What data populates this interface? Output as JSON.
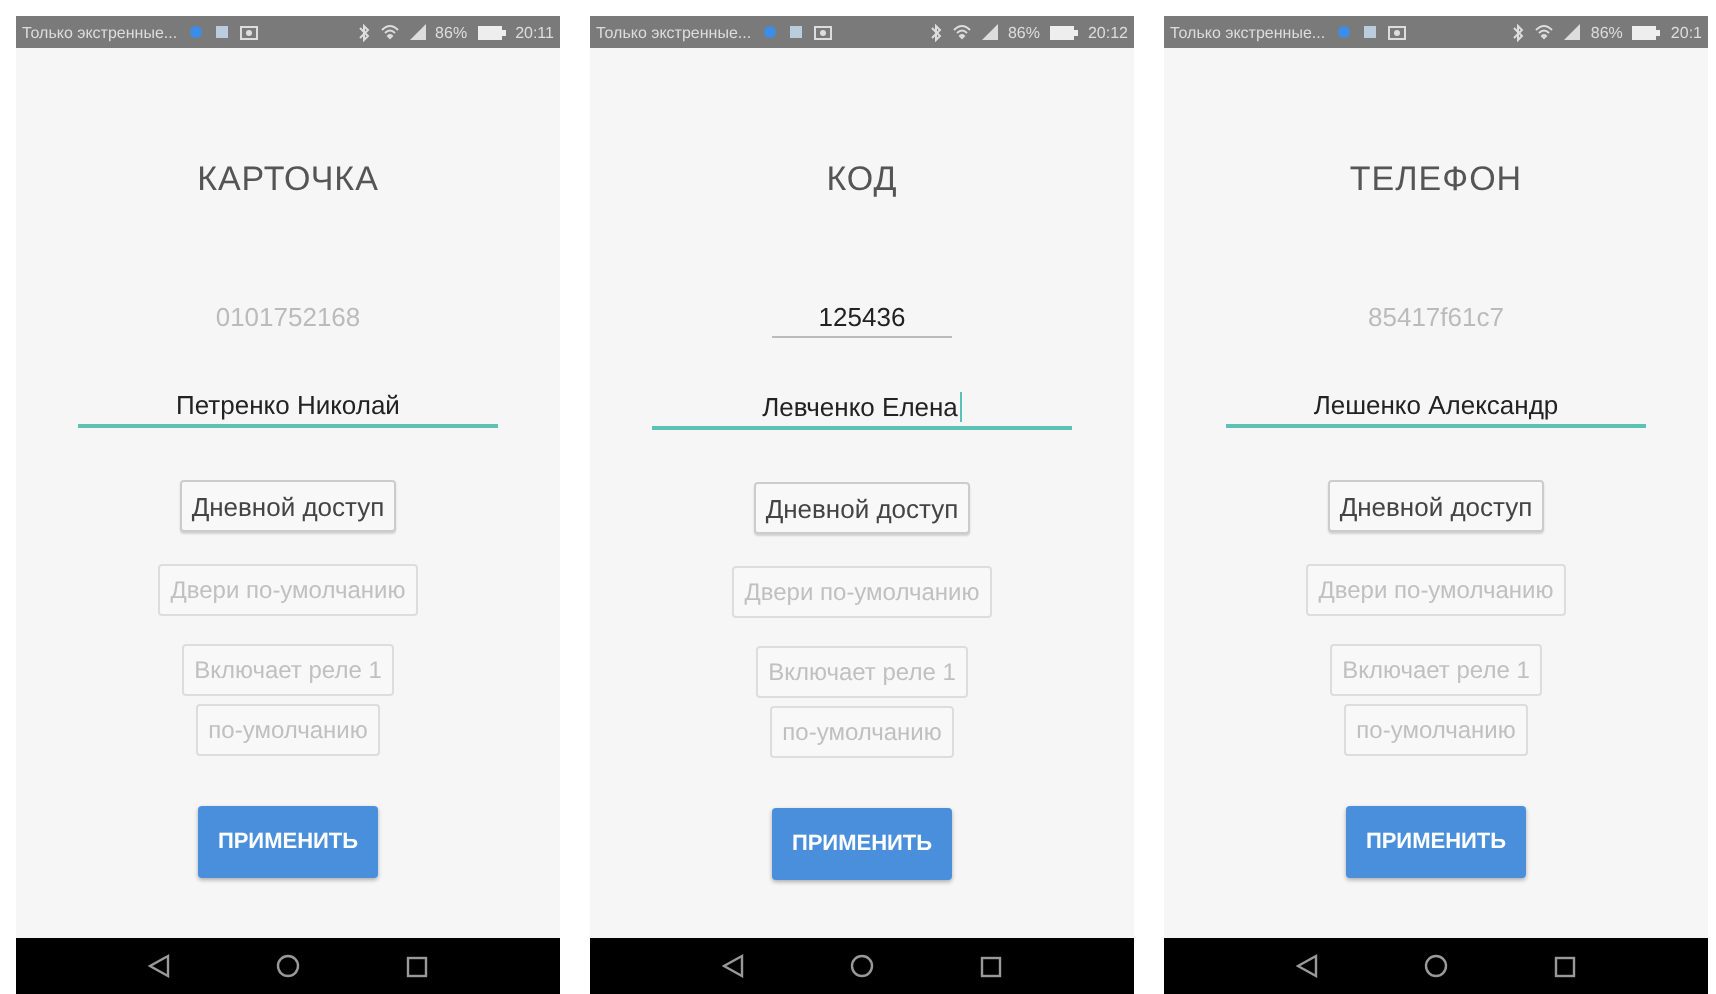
{
  "screens": [
    {
      "status_bar": {
        "notice": "Только экстренные...",
        "battery": "86%",
        "time": "20:11"
      },
      "title": "КАРТОЧКА",
      "code_field": {
        "value": "0101752168",
        "disabled": true
      },
      "name_field": {
        "value": "Петренко Николай",
        "focused": true,
        "cursor": false
      },
      "buttons": [
        {
          "label": "Дневной доступ",
          "disabled": false
        },
        {
          "label": "Двери по-умолчанию",
          "disabled": true
        },
        {
          "label": "Включает реле 1",
          "disabled": true
        },
        {
          "label": "по-умолчанию",
          "disabled": true
        }
      ],
      "apply_button": "ПРИМЕНИТЬ"
    },
    {
      "status_bar": {
        "notice": "Только экстренные...",
        "battery": "86%",
        "time": "20:12"
      },
      "title": "КОД",
      "code_field": {
        "value": "125436",
        "disabled": false
      },
      "name_field": {
        "value": "Левченко Елена",
        "focused": true,
        "cursor": true
      },
      "buttons": [
        {
          "label": "Дневной доступ",
          "disabled": false
        },
        {
          "label": "Двери по-умолчанию",
          "disabled": true
        },
        {
          "label": "Включает реле 1",
          "disabled": true
        },
        {
          "label": "по-умолчанию",
          "disabled": true
        }
      ],
      "apply_button": "ПРИМЕНИТЬ"
    },
    {
      "status_bar": {
        "notice": "Только экстренные...",
        "battery": "86%",
        "time": "20:1"
      },
      "title": "ТЕЛЕФОН",
      "code_field": {
        "value": "85417f61c7",
        "disabled": true
      },
      "name_field": {
        "value": "Лешенко Александр",
        "focused": true,
        "cursor": false
      },
      "buttons": [
        {
          "label": "Дневной доступ",
          "disabled": false
        },
        {
          "label": "Двери по-умолчанию",
          "disabled": true
        },
        {
          "label": "Включает реле 1",
          "disabled": true
        },
        {
          "label": "по-умолчанию",
          "disabled": true
        }
      ],
      "apply_button": "ПРИМЕНИТЬ"
    }
  ]
}
